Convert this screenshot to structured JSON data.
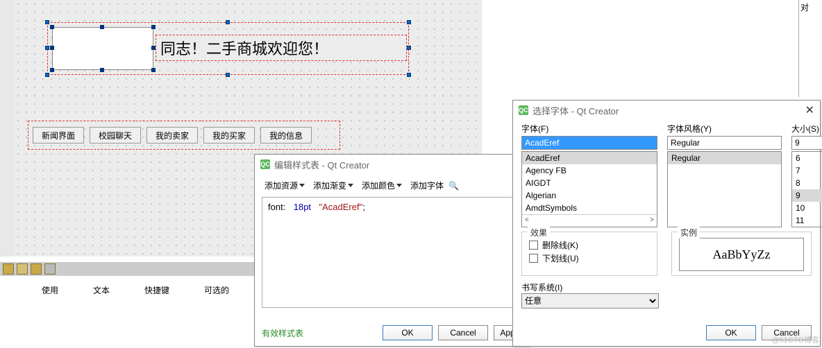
{
  "design": {
    "title_text": "同志！二手商城欢迎您！",
    "buttons": [
      "新闻界面",
      "校园聊天",
      "我的卖家",
      "我的买家",
      "我的信息"
    ]
  },
  "property_tabs": [
    "使用",
    "文本",
    "快捷键",
    "可选的"
  ],
  "right_hint": "对",
  "style_dialog": {
    "title": "编辑样式表 - Qt Creator",
    "toolbar": {
      "add_resource": "添加资源",
      "add_gradient": "添加渐变",
      "add_color": "添加颜色",
      "add_font": "添加字体"
    },
    "css_prop": "font:",
    "css_size": "18pt",
    "css_family": "\"AcadEref\"",
    "css_terminator": ";",
    "valid": "有效样式表",
    "ok": "OK",
    "cancel": "Cancel",
    "apply": "App"
  },
  "font_dialog": {
    "title": "选择字体 - Qt Creator",
    "labels": {
      "font": "字体(F)",
      "style": "字体风格(Y)",
      "size": "大小(S)",
      "effects": "效果",
      "sample": "实例",
      "strike": "删除线(K)",
      "underline": "下划线(U)",
      "writing": "书写系统(I)"
    },
    "font_value": "AcadEref",
    "font_list": [
      "AcadEref",
      "Agency FB",
      "AIGDT",
      "Algerian",
      "AmdtSymbols"
    ],
    "style_value": "Regular",
    "style_list": [
      "Regular"
    ],
    "size_value": "9",
    "size_list": [
      "6",
      "7",
      "8",
      "9",
      "10",
      "11"
    ],
    "writing_value": "任意",
    "sample_text": "AaBbYyZz",
    "ok": "OK",
    "cancel": "Cancel"
  },
  "watermark": "@51CTO博客"
}
